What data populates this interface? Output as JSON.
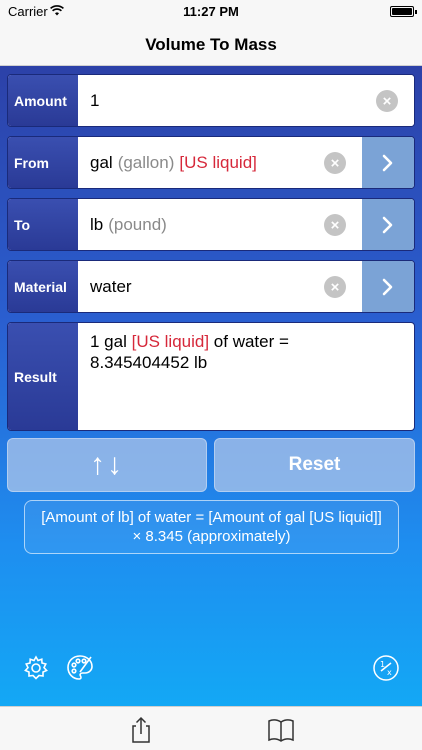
{
  "status_bar": {
    "carrier": "Carrier",
    "time": "11:27 PM"
  },
  "nav": {
    "title": "Volume To Mass"
  },
  "rows": {
    "amount": {
      "label": "Amount",
      "value": "1"
    },
    "from": {
      "label": "From",
      "unit": "gal",
      "unit_name": "(gallon)",
      "qualifier": "[US liquid]"
    },
    "to": {
      "label": "To",
      "unit": "lb",
      "unit_name": "(pound)"
    },
    "material": {
      "label": "Material",
      "value": "water"
    },
    "result": {
      "label": "Result",
      "line1_prefix": "1 gal ",
      "line1_qualifier": "[US liquid]",
      "line1_suffix": " of water =",
      "line2": "8.345404452 lb"
    }
  },
  "buttons": {
    "swap": "↑↓",
    "reset": "Reset"
  },
  "formula": "[Amount of lb] of water = [Amount of gal [US liquid]] × 8.345 (approximately)",
  "icons": {
    "clear": "clear-icon",
    "chevron": "chevron-right-icon",
    "settings": "gear-icon",
    "theme": "palette-icon",
    "fraction": "fraction-icon",
    "share": "share-icon",
    "book": "book-icon",
    "wifi": "wifi-icon",
    "battery": "battery-icon"
  },
  "colors": {
    "accent_red": "#d6283a",
    "label_bg": "#2a3a96",
    "chevron_bg": "#7ba3d6",
    "gradient_top": "#2c41a8",
    "gradient_bottom": "#13a8f5"
  }
}
